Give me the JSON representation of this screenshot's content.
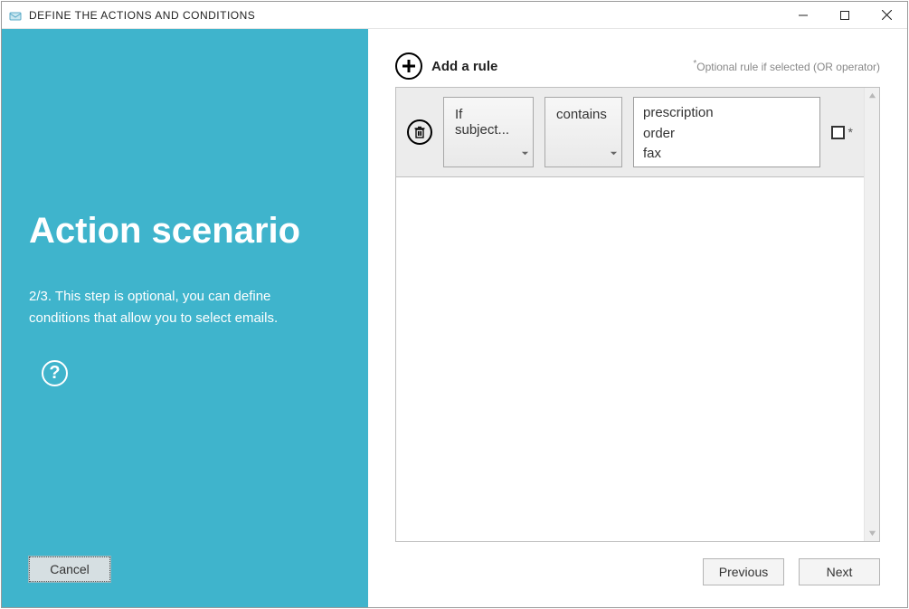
{
  "window": {
    "title": "DEFINE THE ACTIONS AND CONDITIONS"
  },
  "sidebar": {
    "heading": "Action scenario",
    "description": "2/3. This step is optional, you can define conditions that allow you to select emails.",
    "help_tooltip": "?",
    "cancel": "Cancel"
  },
  "main": {
    "add_rule_label": "Add a rule",
    "hint_text": "Optional rule if selected (OR operator)",
    "rules": [
      {
        "field_label": "If subject...",
        "operator_label": "contains",
        "value_text": "prescription\norder\nfax",
        "optional_checked": false
      }
    ]
  },
  "footer": {
    "previous": "Previous",
    "next": "Next"
  }
}
